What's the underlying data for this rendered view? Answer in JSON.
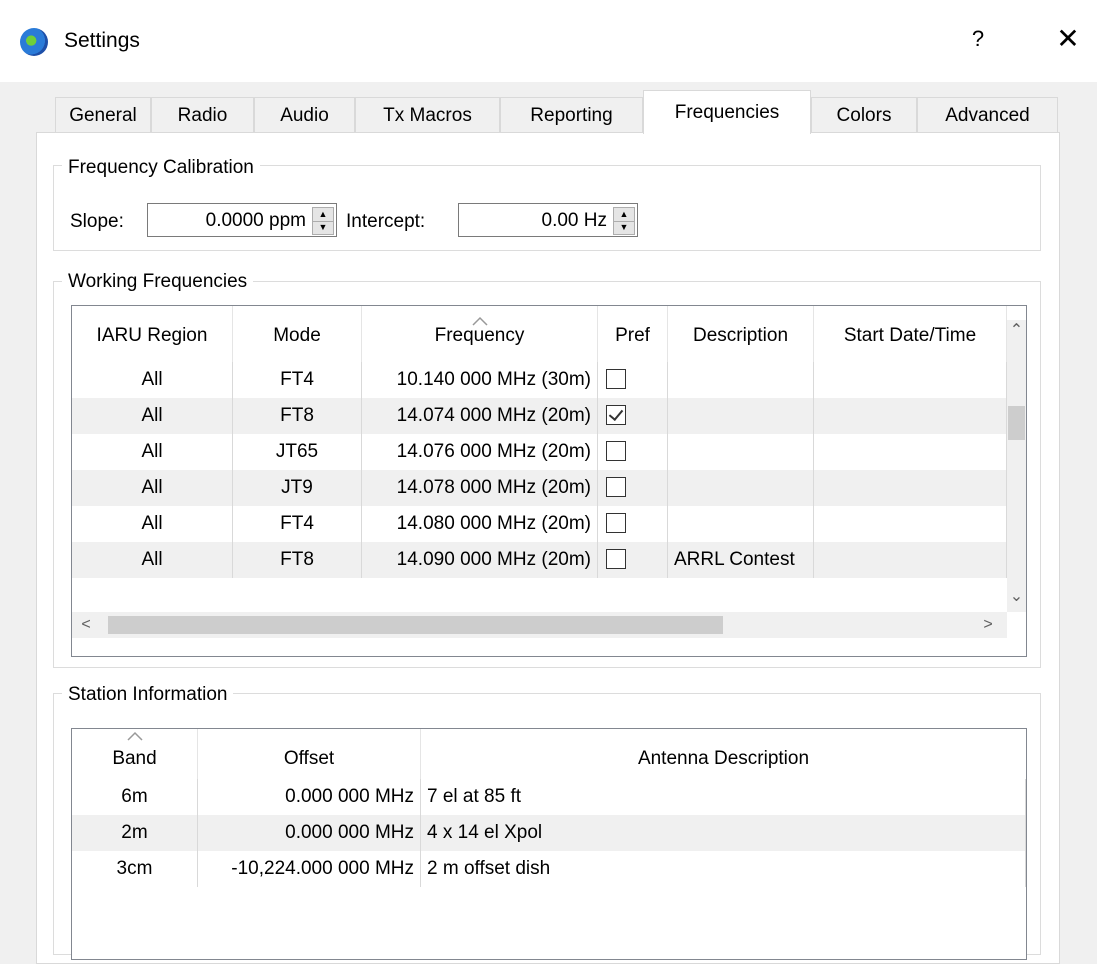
{
  "window": {
    "title": "Settings",
    "help": "?",
    "close": "✕"
  },
  "tabs": [
    {
      "label": "General"
    },
    {
      "label": "Radio"
    },
    {
      "label": "Audio"
    },
    {
      "label": "Tx Macros"
    },
    {
      "label": "Reporting"
    },
    {
      "label": "Frequencies",
      "active": true
    },
    {
      "label": "Colors"
    },
    {
      "label": "Advanced"
    }
  ],
  "calibration": {
    "title": "Frequency Calibration",
    "slope_label": "Slope:",
    "slope_value": "0.0000 ppm",
    "intercept_label": "Intercept:",
    "intercept_value": "0.00 Hz"
  },
  "working": {
    "title": "Working Frequencies",
    "columns": [
      "IARU Region",
      "Mode",
      "Frequency",
      "Pref",
      "Description",
      "Start Date/Time"
    ],
    "rows": [
      {
        "region": "All",
        "mode": "FT4",
        "frequency": "10.140 000 MHz (30m)",
        "pref": false,
        "description": "",
        "start": ""
      },
      {
        "region": "All",
        "mode": "FT8",
        "frequency": "14.074 000 MHz (20m)",
        "pref": true,
        "description": "",
        "start": ""
      },
      {
        "region": "All",
        "mode": "JT65",
        "frequency": "14.076 000 MHz (20m)",
        "pref": false,
        "description": "",
        "start": ""
      },
      {
        "region": "All",
        "mode": "JT9",
        "frequency": "14.078 000 MHz (20m)",
        "pref": false,
        "description": "",
        "start": ""
      },
      {
        "region": "All",
        "mode": "FT4",
        "frequency": "14.080 000 MHz (20m)",
        "pref": false,
        "description": "",
        "start": ""
      },
      {
        "region": "All",
        "mode": "FT8",
        "frequency": "14.090 000 MHz (20m)",
        "pref": false,
        "description": "ARRL Contest",
        "start": ""
      }
    ],
    "scroll_left": "<",
    "scroll_right": ">",
    "scroll_up": "^",
    "scroll_down": "v"
  },
  "station": {
    "title": "Station Information",
    "columns": [
      "Band",
      "Offset",
      "Antenna Description"
    ],
    "rows": [
      {
        "band": "6m",
        "offset": "0.000 000 MHz",
        "antenna": "7 el at 85 ft"
      },
      {
        "band": "2m",
        "offset": "0.000 000 MHz",
        "antenna": "4 x 14 el Xpol"
      },
      {
        "band": "3cm",
        "offset": "-10,224.000 000 MHz",
        "antenna": "2 m offset dish"
      }
    ]
  }
}
